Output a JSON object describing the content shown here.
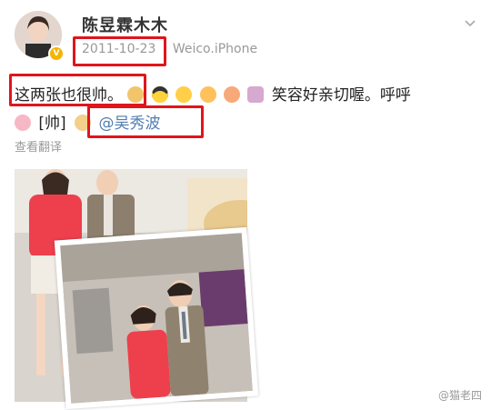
{
  "post": {
    "username": "陈昱霖木木",
    "date": "2011-10-23",
    "source": "Weico.iPhone",
    "text_part1": "这两张也很帅。",
    "text_part2": "笑容好亲切喔。呼呼",
    "line2_prefix": "[帅]",
    "mention": "@吴秀波",
    "translate": "查看翻译"
  },
  "watermark": "@猫老四",
  "icons": {
    "avatar": "avatar",
    "verified": "verified-badge-icon",
    "menu": "chevron-down-icon",
    "emojis": [
      "person-emoji",
      "sunglasses-emoji",
      "thinking-emoji",
      "shy-emoji",
      "laughing-emoji",
      "camera-emoji",
      "pig-emoji",
      "cake-emoji"
    ]
  },
  "colors": {
    "highlight": "#e0151b",
    "mention": "#507daf"
  }
}
